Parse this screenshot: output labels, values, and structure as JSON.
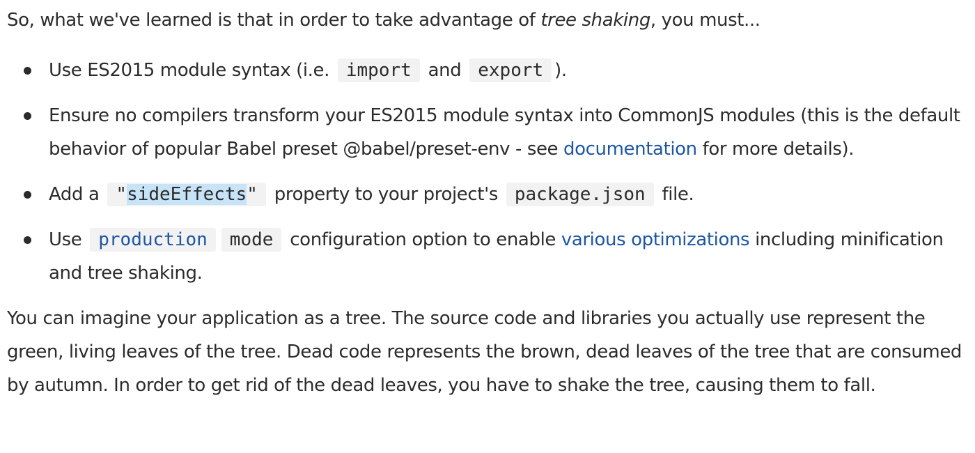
{
  "intro": {
    "before": "So, what we've learned is that in order to take advantage of ",
    "emphasis": "tree shaking",
    "after": ", you must..."
  },
  "bullets": [
    {
      "t1": "Use ES2015 module syntax (i.e. ",
      "code1": "import",
      "t2": " and ",
      "code2": "export",
      "t3": ")."
    },
    {
      "t1": "Ensure no compilers transform your ES2015 module syntax into CommonJS modules (this is the default behavior of popular Babel preset @babel/preset-env - see ",
      "link": "documentation",
      "t2": " for more details)."
    },
    {
      "t1": "Add a ",
      "code1_open": "\"",
      "code1_selected": "sideEffects",
      "code1_close": "\"",
      "t2": " property to your project's ",
      "code2": "package.json",
      "t3": " file."
    },
    {
      "t1": "Use ",
      "code1": "production",
      "code2": "mode",
      "t2": " configuration option to enable ",
      "link": "various optimizations",
      "t3": " including minification and tree shaking."
    }
  ],
  "outro": "You can imagine your application as a tree. The source code and libraries you actually use represent the green, living leaves of the tree. Dead code represents the brown, dead leaves of the tree that are consumed by autumn. In order to get rid of the dead leaves, you have to shake the tree, causing them to fall.",
  "colors": {
    "text": "#2b2b2b",
    "link": "#1d56a3",
    "code_background": "#f2f2f2",
    "selection": "#c7e3f7"
  }
}
